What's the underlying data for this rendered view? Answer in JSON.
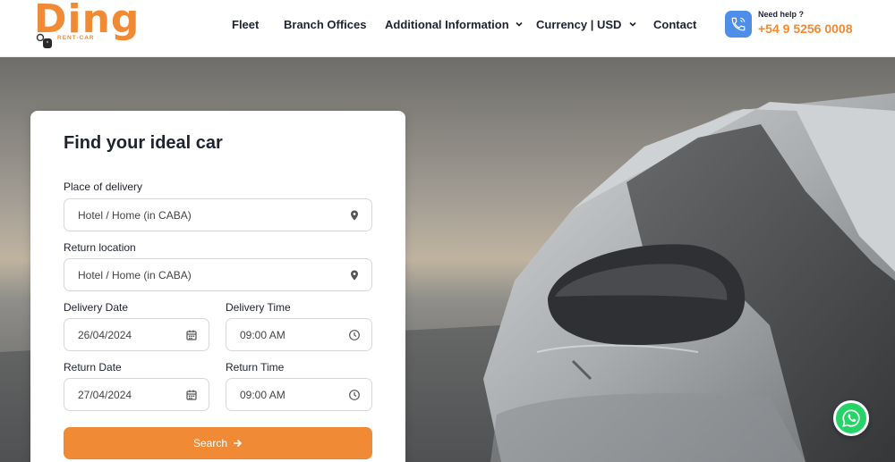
{
  "brand": {
    "name": "Ding",
    "tagline": "RENT-CAR",
    "accent_color": "#f08a35"
  },
  "nav": {
    "items": [
      {
        "label": "Fleet",
        "has_dropdown": false
      },
      {
        "label": "Branch Offices",
        "has_dropdown": false
      },
      {
        "label": "Additional Information",
        "has_dropdown": true
      },
      {
        "label": "Currency | USD",
        "has_dropdown": true
      },
      {
        "label": "Contact",
        "has_dropdown": false
      }
    ]
  },
  "help": {
    "label": "Need help ?",
    "phone": "+54 9 5256 0008",
    "icon": "phone-icon"
  },
  "search_form": {
    "title": "Find your ideal car",
    "delivery_place": {
      "label": "Place of delivery",
      "value": "Hotel / Home (in CABA)",
      "icon": "location-pin-icon"
    },
    "return_location": {
      "label": "Return location",
      "value": "Hotel / Home (in CABA)",
      "icon": "location-pin-icon"
    },
    "delivery_date": {
      "label": "Delivery Date",
      "value": "26/04/2024",
      "icon": "calendar-icon"
    },
    "delivery_time": {
      "label": "Delivery Time",
      "value": "09:00 AM",
      "icon": "clock-icon"
    },
    "return_date": {
      "label": "Return Date",
      "value": "27/04/2024",
      "icon": "calendar-icon"
    },
    "return_time": {
      "label": "Return Time",
      "value": "09:00 AM",
      "icon": "clock-icon"
    },
    "search_label": "Search",
    "search_icon": "arrow-right-icon"
  },
  "whatsapp": {
    "icon": "whatsapp-icon",
    "color": "#25d366"
  }
}
